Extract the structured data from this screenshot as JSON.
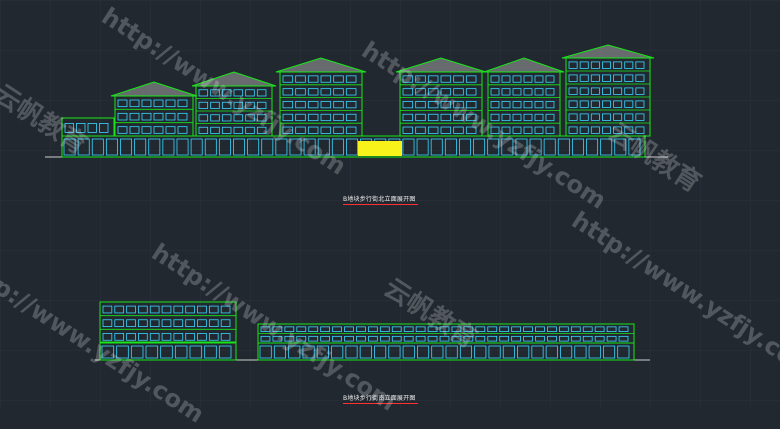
{
  "drawing": {
    "north_elevation_caption": "B地块步行街北立面展开图",
    "south_elevation_caption": "B地块步行街南立面展开图"
  },
  "watermark": {
    "url_text": "http://www.yzfjy.com",
    "brand_text": "云帆教育"
  },
  "colors": {
    "background": "#212830",
    "grid": "#2a323b",
    "outline": "#18e818",
    "window": "#39d6ff",
    "roof": "#a3a3a3",
    "shop_glow": "#f6f21a",
    "caption_underline": "#ff3030",
    "ground_line": "#d0d0d0"
  }
}
